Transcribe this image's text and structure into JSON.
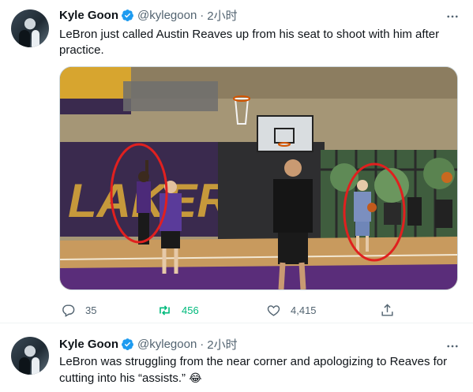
{
  "tweets": [
    {
      "author": {
        "name": "Kyle Goon",
        "handle": "@kylegoon",
        "verified": true
      },
      "separator": "·",
      "time": "2小时",
      "text": "LeBron just called Austin Reaves up from his seat to shoot with him after practice.",
      "media": {
        "wall_text": "LAKERS"
      },
      "stats": {
        "replies": "35",
        "retweets": "456",
        "likes": "4,415"
      }
    },
    {
      "author": {
        "name": "Kyle Goon",
        "handle": "@kylegoon",
        "verified": true
      },
      "separator": "·",
      "time": "2小时",
      "text": "LeBron was struggling from the near corner and apologizing to Reaves for cutting into his “assists.”",
      "emoji": "😂"
    }
  ],
  "icons": {
    "verified": "verified-badge-icon",
    "more": "more-options-icon",
    "reply": "reply-icon",
    "retweet": "retweet-icon",
    "like": "like-icon",
    "share": "share-icon"
  },
  "colors": {
    "verified": "#1d9bf0",
    "retweet_active": "#00ba7c",
    "secondary_text": "#536471",
    "annotation_circle": "#e0201f"
  }
}
